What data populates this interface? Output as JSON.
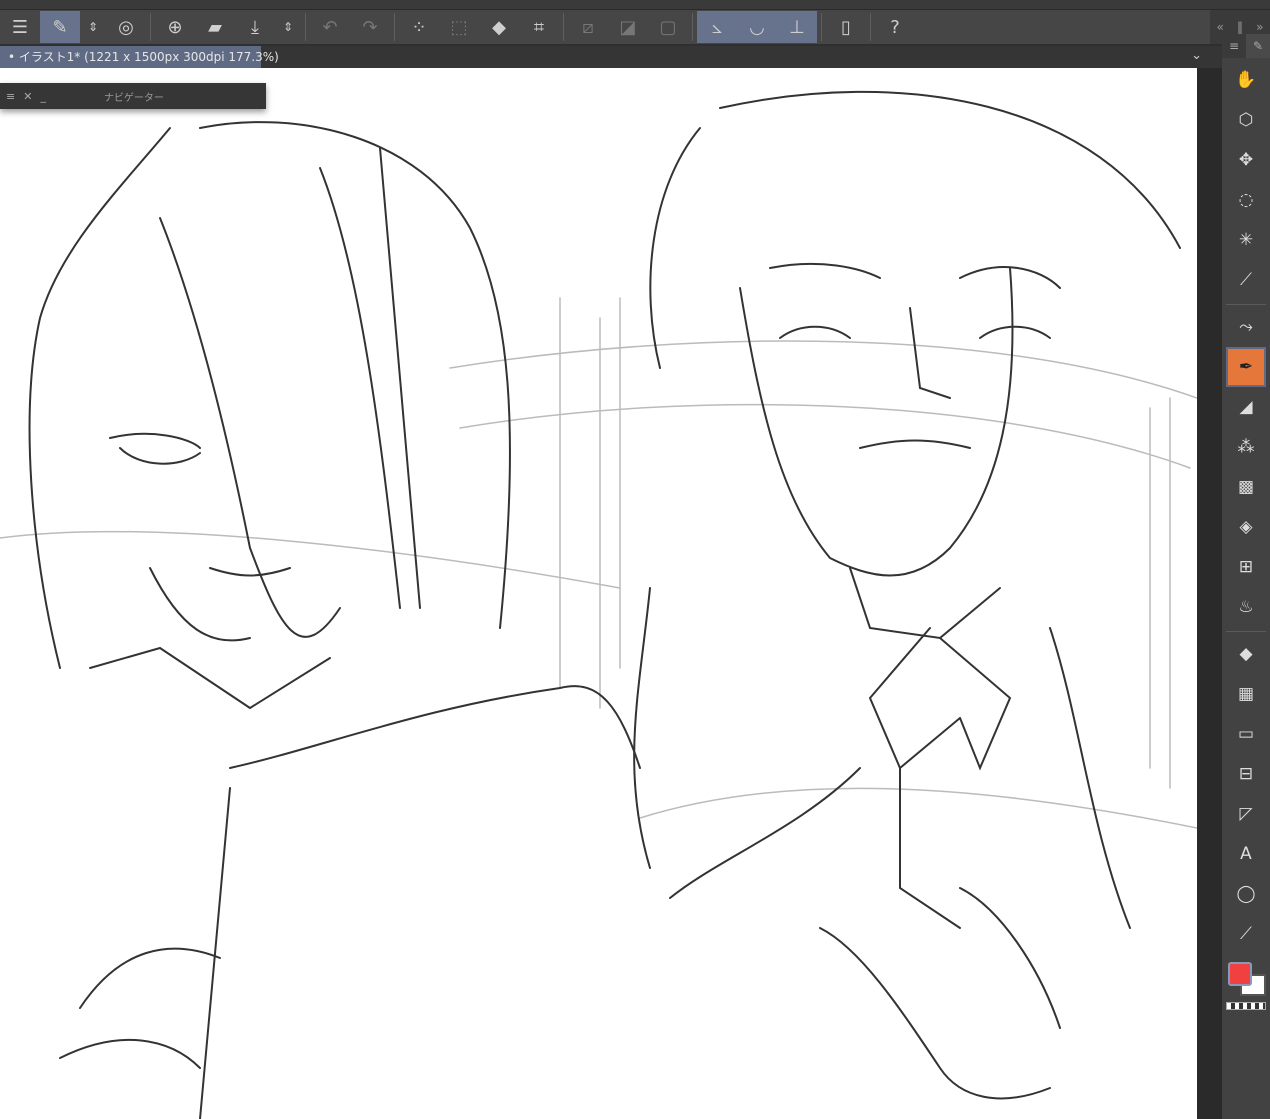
{
  "toolbar": {
    "items": [
      {
        "name": "menu-icon",
        "glyph": "☰"
      },
      {
        "name": "edit-pen-icon",
        "glyph": "✎",
        "selected": true
      },
      {
        "name": "updown-icon",
        "glyph": "⇕"
      },
      {
        "name": "clip-studio-icon",
        "glyph": "◎"
      },
      {
        "name": "new-file-icon",
        "glyph": "🗋"
      },
      {
        "name": "open-folder-icon",
        "glyph": "📂"
      },
      {
        "name": "save-icon",
        "glyph": "⤓"
      },
      {
        "name": "updown-icon-2",
        "glyph": "⇕"
      },
      {
        "name": "undo-icon",
        "glyph": "↶"
      },
      {
        "name": "redo-icon",
        "glyph": "↷"
      },
      {
        "name": "deselect-icon",
        "glyph": "⁘"
      },
      {
        "name": "selection-icon",
        "glyph": "⬚"
      },
      {
        "name": "fill-icon",
        "glyph": "◆"
      },
      {
        "name": "transform-icon",
        "glyph": "⌗"
      },
      {
        "name": "clear-outside-icon",
        "glyph": "⧄"
      },
      {
        "name": "invert-selection-icon",
        "glyph": "◪"
      },
      {
        "name": "show-selection-icon",
        "glyph": "▢"
      },
      {
        "name": "ruler-snap-icon",
        "glyph": "⦣"
      },
      {
        "name": "special-ruler-snap-icon",
        "glyph": "◡"
      },
      {
        "name": "grid-snap-icon",
        "glyph": "⊥"
      },
      {
        "name": "companion-mode-icon",
        "glyph": "▯"
      },
      {
        "name": "help-icon",
        "glyph": "?"
      }
    ]
  },
  "document_tab": {
    "label": "• イラスト1* (1221 x 1500px 300dpi 177.3%)"
  },
  "navigator": {
    "title": "ナビゲーター"
  },
  "tools": [
    "hand",
    "object",
    "move",
    "lasso",
    "auto-select",
    "eyedropper",
    "pen-assist",
    "pen",
    "marker",
    "airbrush",
    "decoration",
    "eraser",
    "blend",
    "liquify",
    "fill",
    "gradient",
    "figure",
    "frame",
    "ruler",
    "text",
    "balloon",
    "correction-line"
  ],
  "colors": {
    "foreground": "#f04040",
    "background": "#ffffff",
    "selected_tool_accent": "#e5773a",
    "toolbar_selected": "#67728c"
  }
}
